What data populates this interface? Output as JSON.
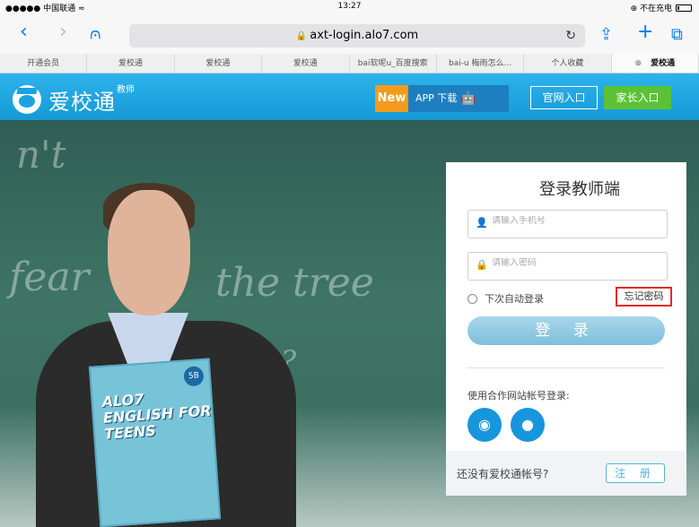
{
  "status_bar": {
    "carrier": "●●●●● 中国联通 ",
    "wifi": "≈",
    "time": "13:27",
    "battery_text": "⊕ 不在充电"
  },
  "browser": {
    "url": "axt-login.alo7.com",
    "lock_icon": "lock-icon",
    "back_glyph": "‹",
    "forward_glyph": "›",
    "bookmarks_glyph": "⩀",
    "reload_glyph": "↻",
    "share_glyph": "⇪",
    "new_tab_glyph": "+",
    "tabs_glyph": "⧉"
  },
  "favorites": [
    {
      "label": "开通会员"
    },
    {
      "label": "爱校通"
    },
    {
      "label": "爱校通"
    },
    {
      "label": "爱校通"
    },
    {
      "label": "bai软呢u_百度搜索"
    },
    {
      "label": "bai-u 梅雨怎么..."
    },
    {
      "label": "个人收藏"
    },
    {
      "label": "爱校通",
      "active": true,
      "close": "⊗"
    }
  ],
  "site": {
    "logo_text": "爱校通",
    "logo_sub": "教师",
    "new_label": "New",
    "app_label": "APP 下载",
    "android_icon": "android-icon",
    "apple_icon": "apple-icon",
    "guanwang": "官网入口",
    "jiazhang": "家长入口"
  },
  "hero": {
    "chalk_1": "n't",
    "chalk_2": "fear",
    "chalk_3": "the tree",
    "chalk_4": "ss ?",
    "book_title": "ALO7 ENGLISH FOR TEENS",
    "book_level": "5B"
  },
  "login": {
    "title": "登录教师端",
    "phone_placeholder": "请输入手机号",
    "password_placeholder": "请输入密码",
    "remember_label": "下次自动登录",
    "forgot_label": "忘记密码",
    "login_button": "登 录",
    "partner_label": "使用合作网站帐号登录:",
    "no_account": "还没有爱校通帐号?",
    "register_button": "注 册"
  },
  "colors": {
    "header_blue": "#1aa3e0",
    "new_orange": "#f39b1c",
    "parent_green": "#5bc236",
    "forgot_highlight": "#e12b2b"
  }
}
